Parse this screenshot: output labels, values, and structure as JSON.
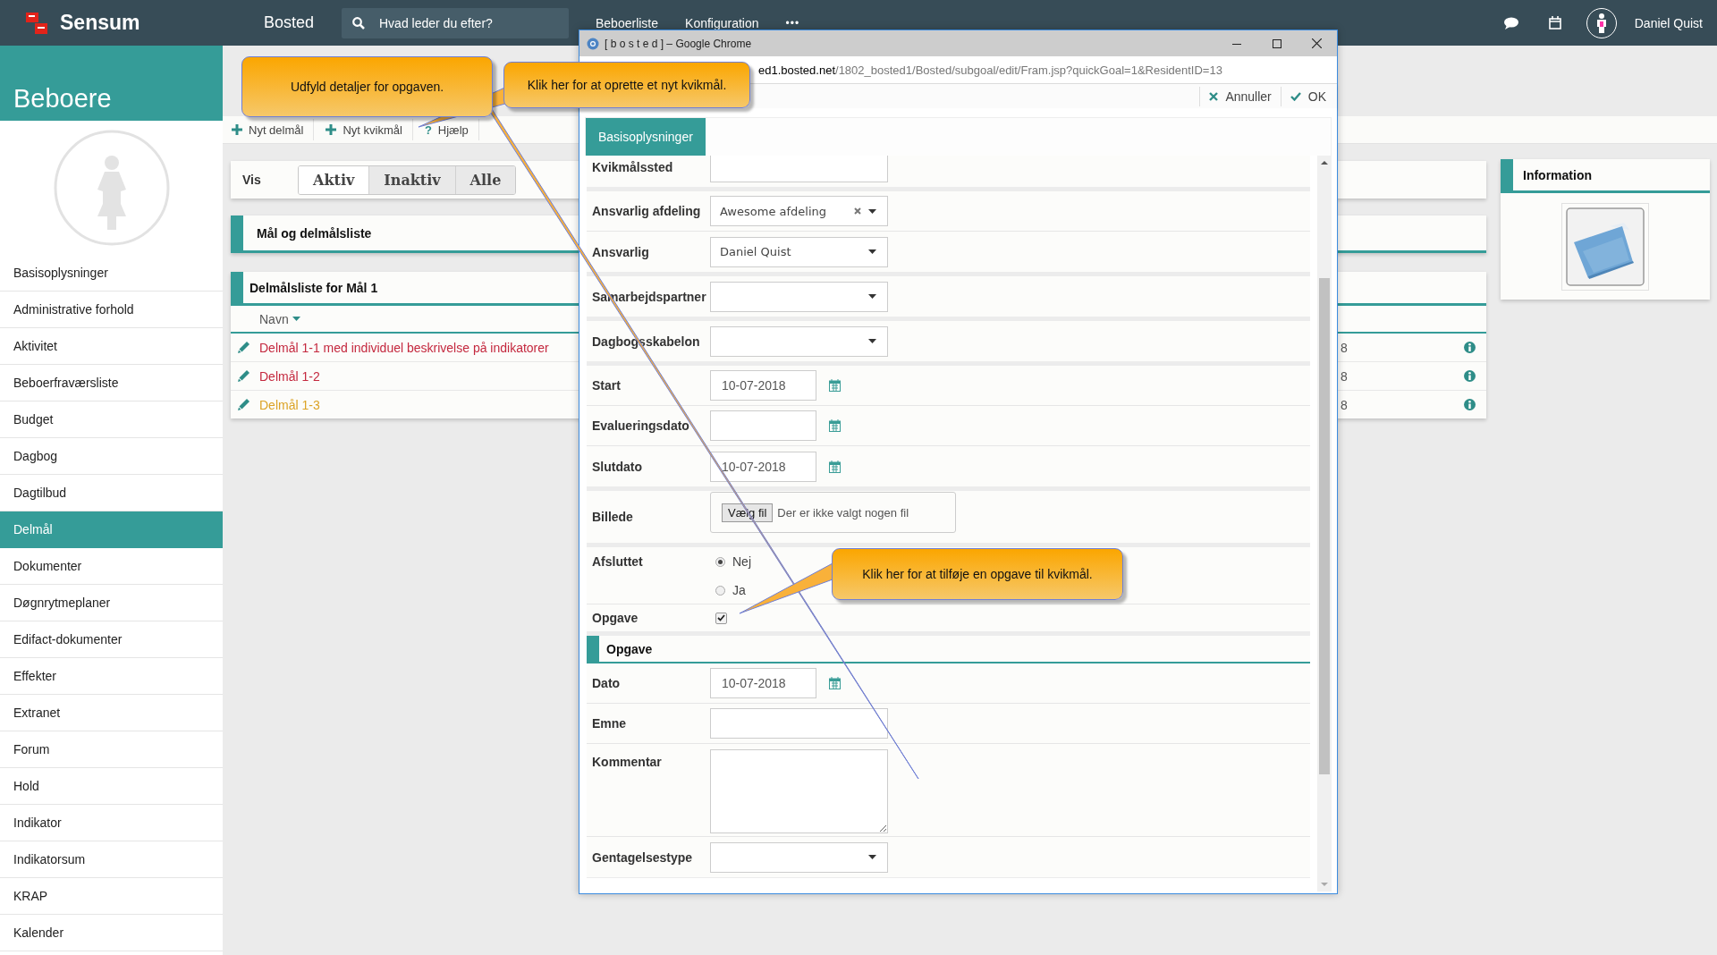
{
  "topbar": {
    "logo": "Sensum",
    "context": "Bosted",
    "search": {
      "placeholder": "Hvad leder du efter?"
    },
    "nav": [
      "Beboerliste",
      "Konfiguration"
    ],
    "more": "•••",
    "user": "Daniel Quist"
  },
  "sidebar": {
    "title": "Beboere",
    "items": [
      {
        "label": "Basisoplysninger",
        "selected": false
      },
      {
        "label": "Administrative forhold",
        "selected": false
      },
      {
        "label": "Aktivitet",
        "selected": false
      },
      {
        "label": "Beboerfraværsliste",
        "selected": false
      },
      {
        "label": "Budget",
        "selected": false
      },
      {
        "label": "Dagbog",
        "selected": false
      },
      {
        "label": "Dagtilbud",
        "selected": false
      },
      {
        "label": "Delmål",
        "selected": true
      },
      {
        "label": "Dokumenter",
        "selected": false
      },
      {
        "label": "Døgnrytmeplaner",
        "selected": false
      },
      {
        "label": "Edifact-dokumenter",
        "selected": false
      },
      {
        "label": "Effekter",
        "selected": false
      },
      {
        "label": "Extranet",
        "selected": false
      },
      {
        "label": "Forum",
        "selected": false
      },
      {
        "label": "Hold",
        "selected": false
      },
      {
        "label": "Indikator",
        "selected": false
      },
      {
        "label": "Indikatorsum",
        "selected": false
      },
      {
        "label": "KRAP",
        "selected": false
      },
      {
        "label": "Kalender",
        "selected": false
      }
    ]
  },
  "toolbar": [
    {
      "kind": "add",
      "label": "Nyt delmål"
    },
    {
      "kind": "add",
      "label": "Nyt kvikmål"
    },
    {
      "kind": "help",
      "icon": "?",
      "label": "Hjælp"
    }
  ],
  "filter": {
    "label": "Vis",
    "options": [
      {
        "label": "Aktiv",
        "selected": true
      },
      {
        "label": "Inaktiv",
        "selected": false
      },
      {
        "label": "Alle",
        "selected": false
      }
    ]
  },
  "goal_panel": {
    "title": "Mål og delmålsliste"
  },
  "subgoal_list": {
    "title": "Delmålsliste for Mål 1",
    "columns": [
      "Navn"
    ],
    "rows": [
      {
        "name": "Delmål 1-1 med individuel beskrivelse på indikatorer",
        "color": "#c4283e",
        "column_2": "8"
      },
      {
        "name": "Delmål 1-2",
        "color": "#c4283e",
        "column_2": "8"
      },
      {
        "name": "Delmål 1-3",
        "color": "#dca326",
        "column_2": "8"
      }
    ]
  },
  "info_panel": {
    "title": "Information"
  },
  "popup": {
    "title": "[ b o s t e d ] – Google Chrome",
    "url_host": "ed1.bosted.net",
    "url_path": "/1802_bosted1/Bosted/subgoal/edit/Fram.jsp?quickGoal=1&ResidentID=13",
    "actions": [
      {
        "kind": "cancel",
        "label": "Annuller"
      },
      {
        "kind": "ok",
        "label": "OK"
      }
    ],
    "tab": "Basisoplysninger",
    "groups": [
      {
        "fields": [
          {
            "kind": "text",
            "label": "Kvikmålssted"
          }
        ]
      },
      {
        "fields": [
          {
            "kind": "select",
            "label": "Ansvarlig afdeling",
            "value": "Awesome afdeling",
            "clearable": true
          },
          {
            "kind": "select",
            "label": "Ansvarlig",
            "value": "Daniel Quist"
          }
        ]
      },
      {
        "fields": [
          {
            "kind": "select",
            "label": "Samarbejdspartner"
          }
        ]
      },
      {
        "fields": [
          {
            "kind": "select",
            "label": "Dagbogsskabelon"
          }
        ]
      },
      {
        "fields": [
          {
            "kind": "date",
            "label": "Start",
            "value": "10-07-2018"
          },
          {
            "kind": "date",
            "label": "Evalueringsdato"
          },
          {
            "kind": "date",
            "label": "Slutdato",
            "value": "10-07-2018"
          }
        ]
      },
      {
        "fields": [
          {
            "kind": "file",
            "label": "Billede",
            "button": "Vælg fil",
            "status": "Der er ikke valgt nogen fil"
          }
        ]
      },
      {
        "fields": [
          {
            "kind": "radio",
            "label": "Afsluttet",
            "options": [
              {
                "label": "Nej",
                "selected": true
              },
              {
                "label": "Ja",
                "selected": false
              }
            ]
          },
          {
            "kind": "checkbox",
            "label": "Opgave",
            "checked": true
          }
        ]
      },
      {
        "kind": "section",
        "title": "Opgave",
        "fields": [
          {
            "kind": "date",
            "label": "Dato",
            "value": "10-07-2018"
          },
          {
            "kind": "text",
            "label": "Emne"
          },
          {
            "kind": "textarea",
            "label": "Kommentar"
          },
          {
            "kind": "select",
            "label": "Gentagelsestype"
          }
        ]
      }
    ]
  },
  "callouts": [
    {
      "text": "Udfyld detaljer for opgaven."
    },
    {
      "text": "Klik her for at oprette et nyt kvikmål."
    },
    {
      "text": "Klik her for at tilføje en opgave til kvikmål."
    }
  ]
}
